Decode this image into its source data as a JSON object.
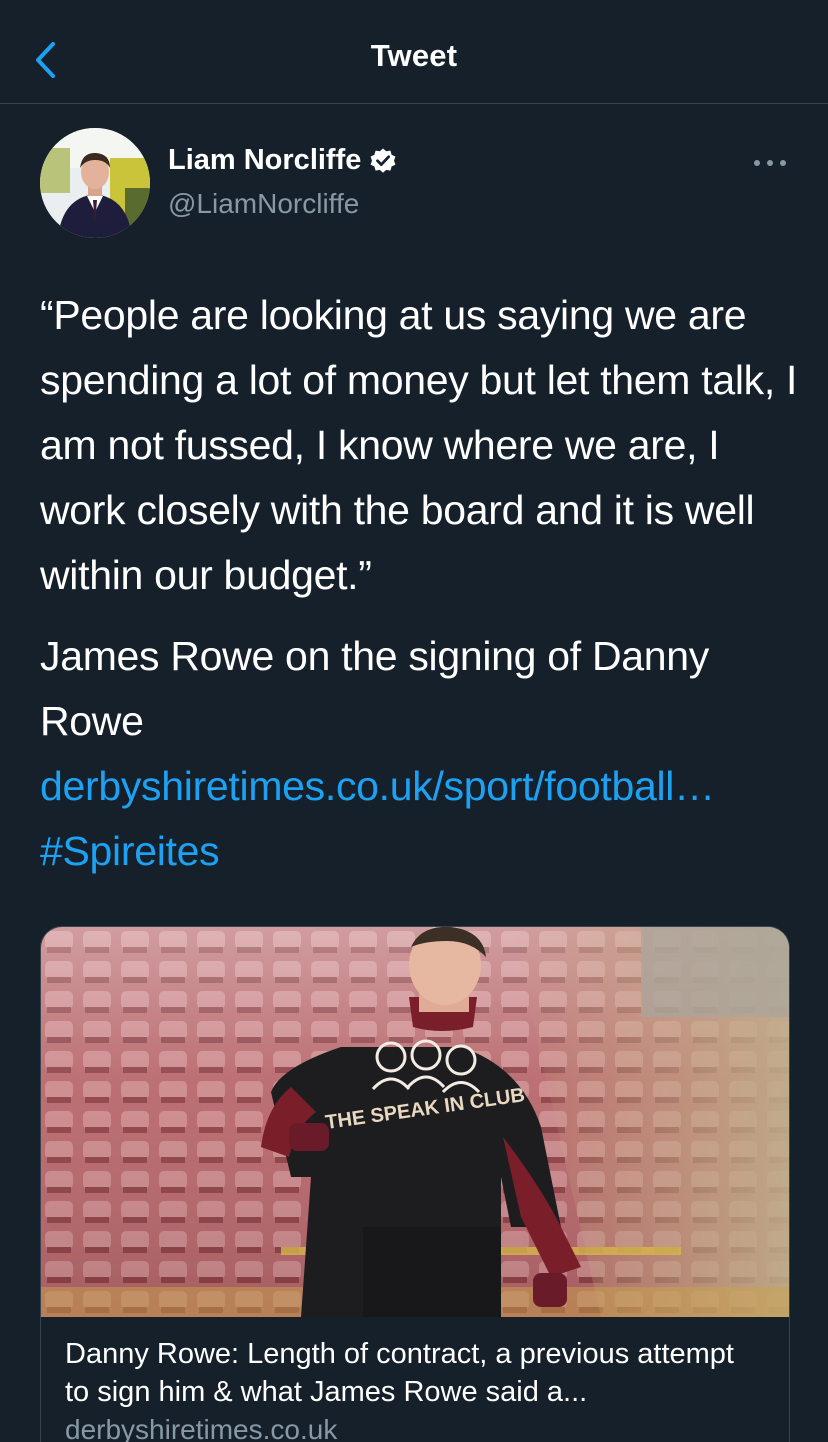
{
  "header": {
    "title": "Tweet",
    "back_icon": "chevron-left-icon"
  },
  "author": {
    "display_name": "Liam Norcliffe",
    "verified": true,
    "handle": "@LiamNorcliffe",
    "more_icon": "ellipsis-icon"
  },
  "tweet": {
    "quote": "“People are looking at us saying we are spending a lot of money but let them talk, I am not fussed, I know where we are, I work closely with the board and it is well within our budget.”",
    "caption": "James Rowe on the signing of Danny Rowe",
    "link": "derbyshiretimes.co.uk/sport/football…",
    "hashtag": "#Spireites"
  },
  "link_card": {
    "title": "Danny Rowe: Length of contract, a previous attempt to sign him & what James Rowe said a...",
    "domain": "derbyshiretimes.co.uk",
    "shirt_text": "THE SPEAK IN CLUB"
  },
  "colors": {
    "background": "#15202b",
    "accent": "#1da1f2",
    "secondary_text": "#8899a6",
    "border": "#38444d"
  }
}
